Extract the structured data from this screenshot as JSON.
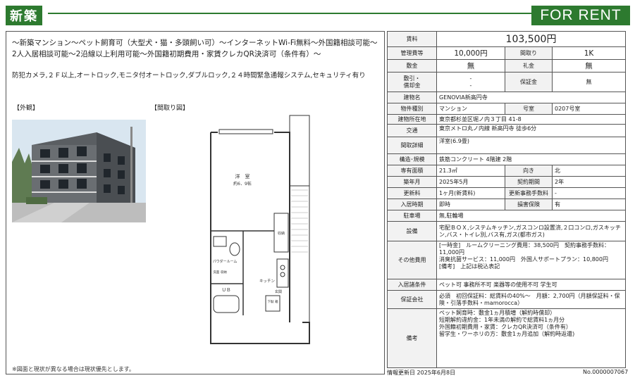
{
  "header": {
    "badge": "新築",
    "for_rent": "FOR RENT",
    "color": "#2d7a2f"
  },
  "catchcopy": "〜新築マンション〜ペット飼育可（大型犬・猫・多頭飼い可）〜インターネットWi-Fi無料〜外国籍相談可能〜2人入居相談可能〜2沿線以上利用可能〜外国籍初期費用・家賃クレカQR決済可（条件有）〜",
  "features": "防犯カメラ,２Ｆ以上,オートロック,モニタ付オートロック,ダブルロック,２４時間緊急通報システム,セキュリティ有り",
  "labels": {
    "exterior": "【外観】",
    "floorplan": "【間取り図】"
  },
  "floorplan_text": {
    "room": "洋　室",
    "room_size": "約6．9帖",
    "powder": "パウダールーム",
    "kitchen": "キッチン",
    "ub": "ＵＢ",
    "entrance": "玄関",
    "closet": "収納",
    "shoes": "下駄\n箱",
    "bath_storage": "洗面\n収納"
  },
  "footnote": "※図面と現状が異なる場合は現状優先とします。",
  "table": {
    "rent_label": "賃料",
    "rent": "103,500円",
    "mgmt_label": "管理費等",
    "mgmt": "10,000円",
    "layout_label": "間取り",
    "layout": "1K",
    "deposit_label": "敷金",
    "deposit": "無",
    "keymoney_label": "礼金",
    "keymoney": "無",
    "shikibiki_label": "敷引・\n償却金",
    "shikibiki": "-\n-",
    "guarantee_label": "保証金",
    "guarantee": "無",
    "building_label": "建物名",
    "building": "GENOVIA新高円寺",
    "type_label": "物件種別",
    "type": "マンション",
    "roomno_label": "号室",
    "roomno": "0207号室",
    "address_label": "建物所在地",
    "address": "東京都杉並区堀ノ内３丁目 41-8",
    "transport_label": "交通",
    "transport": "東京メトロ丸ノ内線 新高円寺 徒歩6分",
    "detail_label": "間取詳細",
    "detail": "洋室(6.9畳)",
    "structure_label": "構造･規模",
    "structure": "鉄筋コンクリート 4階建 2階",
    "area_label": "専有面積",
    "area": "21.3㎡",
    "direction_label": "向き",
    "direction": "北",
    "built_label": "築年月",
    "built": "2025年5月",
    "contract_label": "契約期間",
    "contract": "2年",
    "renew_label": "更新料",
    "renew": "1ヶ月(新賃料)",
    "renewfee_label": "更新事務手数料",
    "renewfee": "-",
    "movein_label": "入居時期",
    "movein": "即時",
    "insurance_label": "損害保険",
    "insurance": "有",
    "parking_label": "駐車場",
    "parking": "無,駐輪場",
    "equip_label": "設備",
    "equip": "宅配ＢＯＸ,システムキッチン,ガスコンロ設置済,２口コンロ,ガスキッチン,バス・トイレ別,バス有,ガス(都市ガス)",
    "other_label": "その他費用",
    "other": "[一時金]　ルームクリーニング費用：38,500円　契約事務手数料：11,000円\n消臭抗菌サービス：11,000円　外国人サポートプラン：10,800円\n[備考]　上記は税込表記",
    "cond_label": "入居諸条件",
    "cond": "ペット可 事務所不可 楽器等の使用不可 学生可",
    "company_label": "保証会社",
    "company": "必須　初回保証料：総賃料の40%〜　月額：2,700円（月額保証料・保険・引落手数料・mamorocca）",
    "remarks_label": "備考",
    "remarks": "ペット飼育時：敷金1ヵ月積増（解約時償却）\n短期解約違約金：1年未満の解約で総賃料1ヵ月分\n外国籍初期費用・家賃：クレカQR決済可（条件有）\n留学生・ワーホリの方：敷金1ヵ月追加（解約時返還)"
  },
  "footer": {
    "date": "情報更新日 2025年6月8日",
    "number": "No.0000007067"
  }
}
